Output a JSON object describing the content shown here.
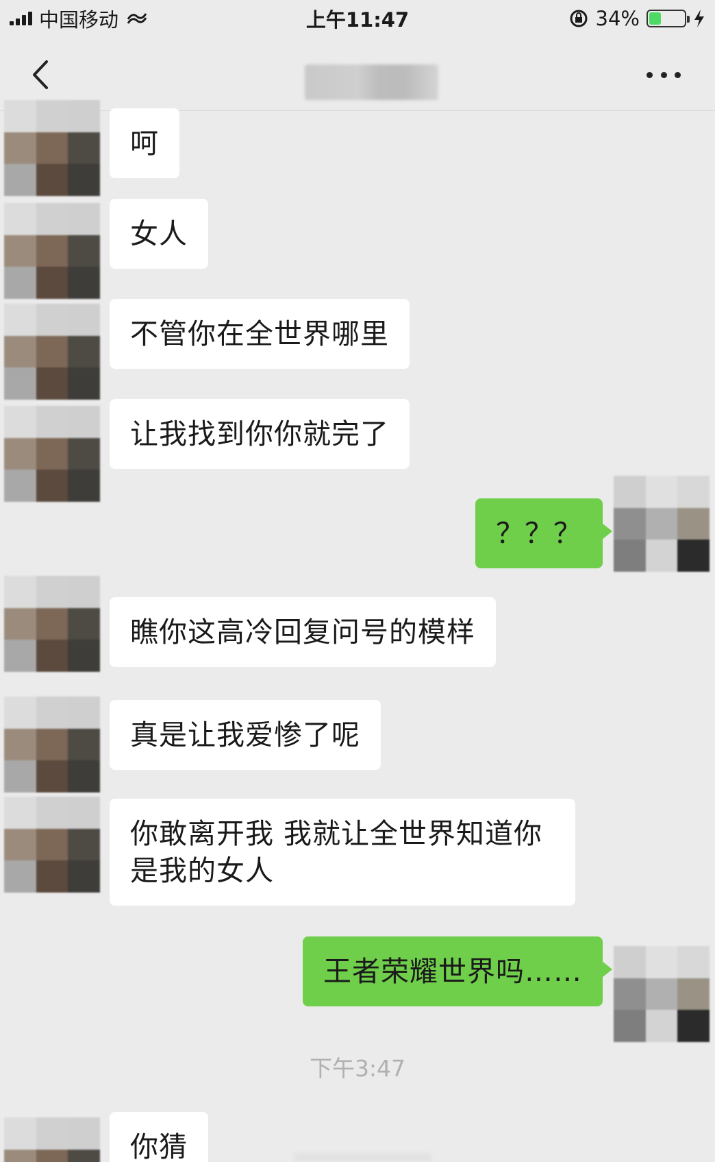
{
  "status_bar": {
    "carrier": "中国移动",
    "time": "上午11:47",
    "battery": "34%",
    "battery_level": 0.34
  },
  "nav": {
    "back_icon": "chevron-left-icon",
    "more_icon": "more-dots-icon"
  },
  "messages": [
    {
      "side": "left",
      "text": "呵"
    },
    {
      "side": "left",
      "text": "女人"
    },
    {
      "side": "left",
      "text": "不管你在全世界哪里"
    },
    {
      "side": "left",
      "text": "让我找到你你就完了"
    },
    {
      "side": "right",
      "text": "？？？"
    },
    {
      "side": "left",
      "text": "瞧你这高冷回复问号的模样"
    },
    {
      "side": "left",
      "text": "真是让我爱惨了呢"
    },
    {
      "side": "left",
      "text": "你敢离开我 我就让全世界知道你是我的女人"
    },
    {
      "side": "right",
      "text": "王者荣耀世界吗……"
    },
    {
      "side": "left",
      "text": "你猜"
    }
  ],
  "time_divider": "下午3:47",
  "colors": {
    "background": "#ebebeb",
    "outgoing_bubble": "#6fcf4b",
    "incoming_bubble": "#ffffff"
  }
}
